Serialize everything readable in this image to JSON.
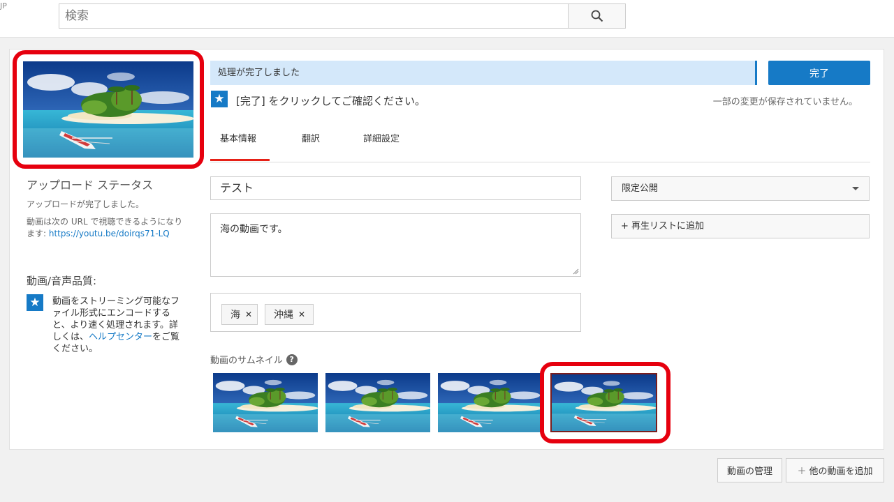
{
  "header": {
    "region": "JP",
    "search_placeholder": "検索",
    "search_icon": "search-icon"
  },
  "upload_status": {
    "title": "アップロード ステータス",
    "complete": "アップロードが完了しました。",
    "url_prefix": "動画は次の URL で視聴できるようになります: ",
    "url": "https://youtu.be/doirqs71-LQ"
  },
  "quality": {
    "title": "動画/音声品質:",
    "text_prefix": "動画をストリーミング可能なファイル形式にエンコードすると、より速く処理されます。詳しくは、",
    "help_link": "ヘルプセンター",
    "text_suffix": "をご覧ください。"
  },
  "progress": {
    "text": "処理が完了しました",
    "done_button": "完了",
    "hint": "[完了] をクリックしてご確認ください。",
    "unsaved": "一部の変更が保存されていません。"
  },
  "tabs": [
    {
      "label": "基本情報",
      "active": true
    },
    {
      "label": "翻訳",
      "active": false
    },
    {
      "label": "詳細設定",
      "active": false
    }
  ],
  "form": {
    "title": "テスト",
    "description": "海の動画です。",
    "tags": [
      "海",
      "沖縄"
    ],
    "privacy": "限定公開",
    "playlist": "+ 再生リストに追加"
  },
  "thumbnails": {
    "label": "動画のサムネイル",
    "selected_index": 3,
    "count": 4
  },
  "footer": {
    "manage": "動画の管理",
    "add_more": "他の動画を追加",
    "add_icon": "＋"
  },
  "colors": {
    "accent": "#167ac6",
    "tab_active": "#e62117",
    "highlight": "#e6000e",
    "progress_bg": "#d4e8fa"
  }
}
